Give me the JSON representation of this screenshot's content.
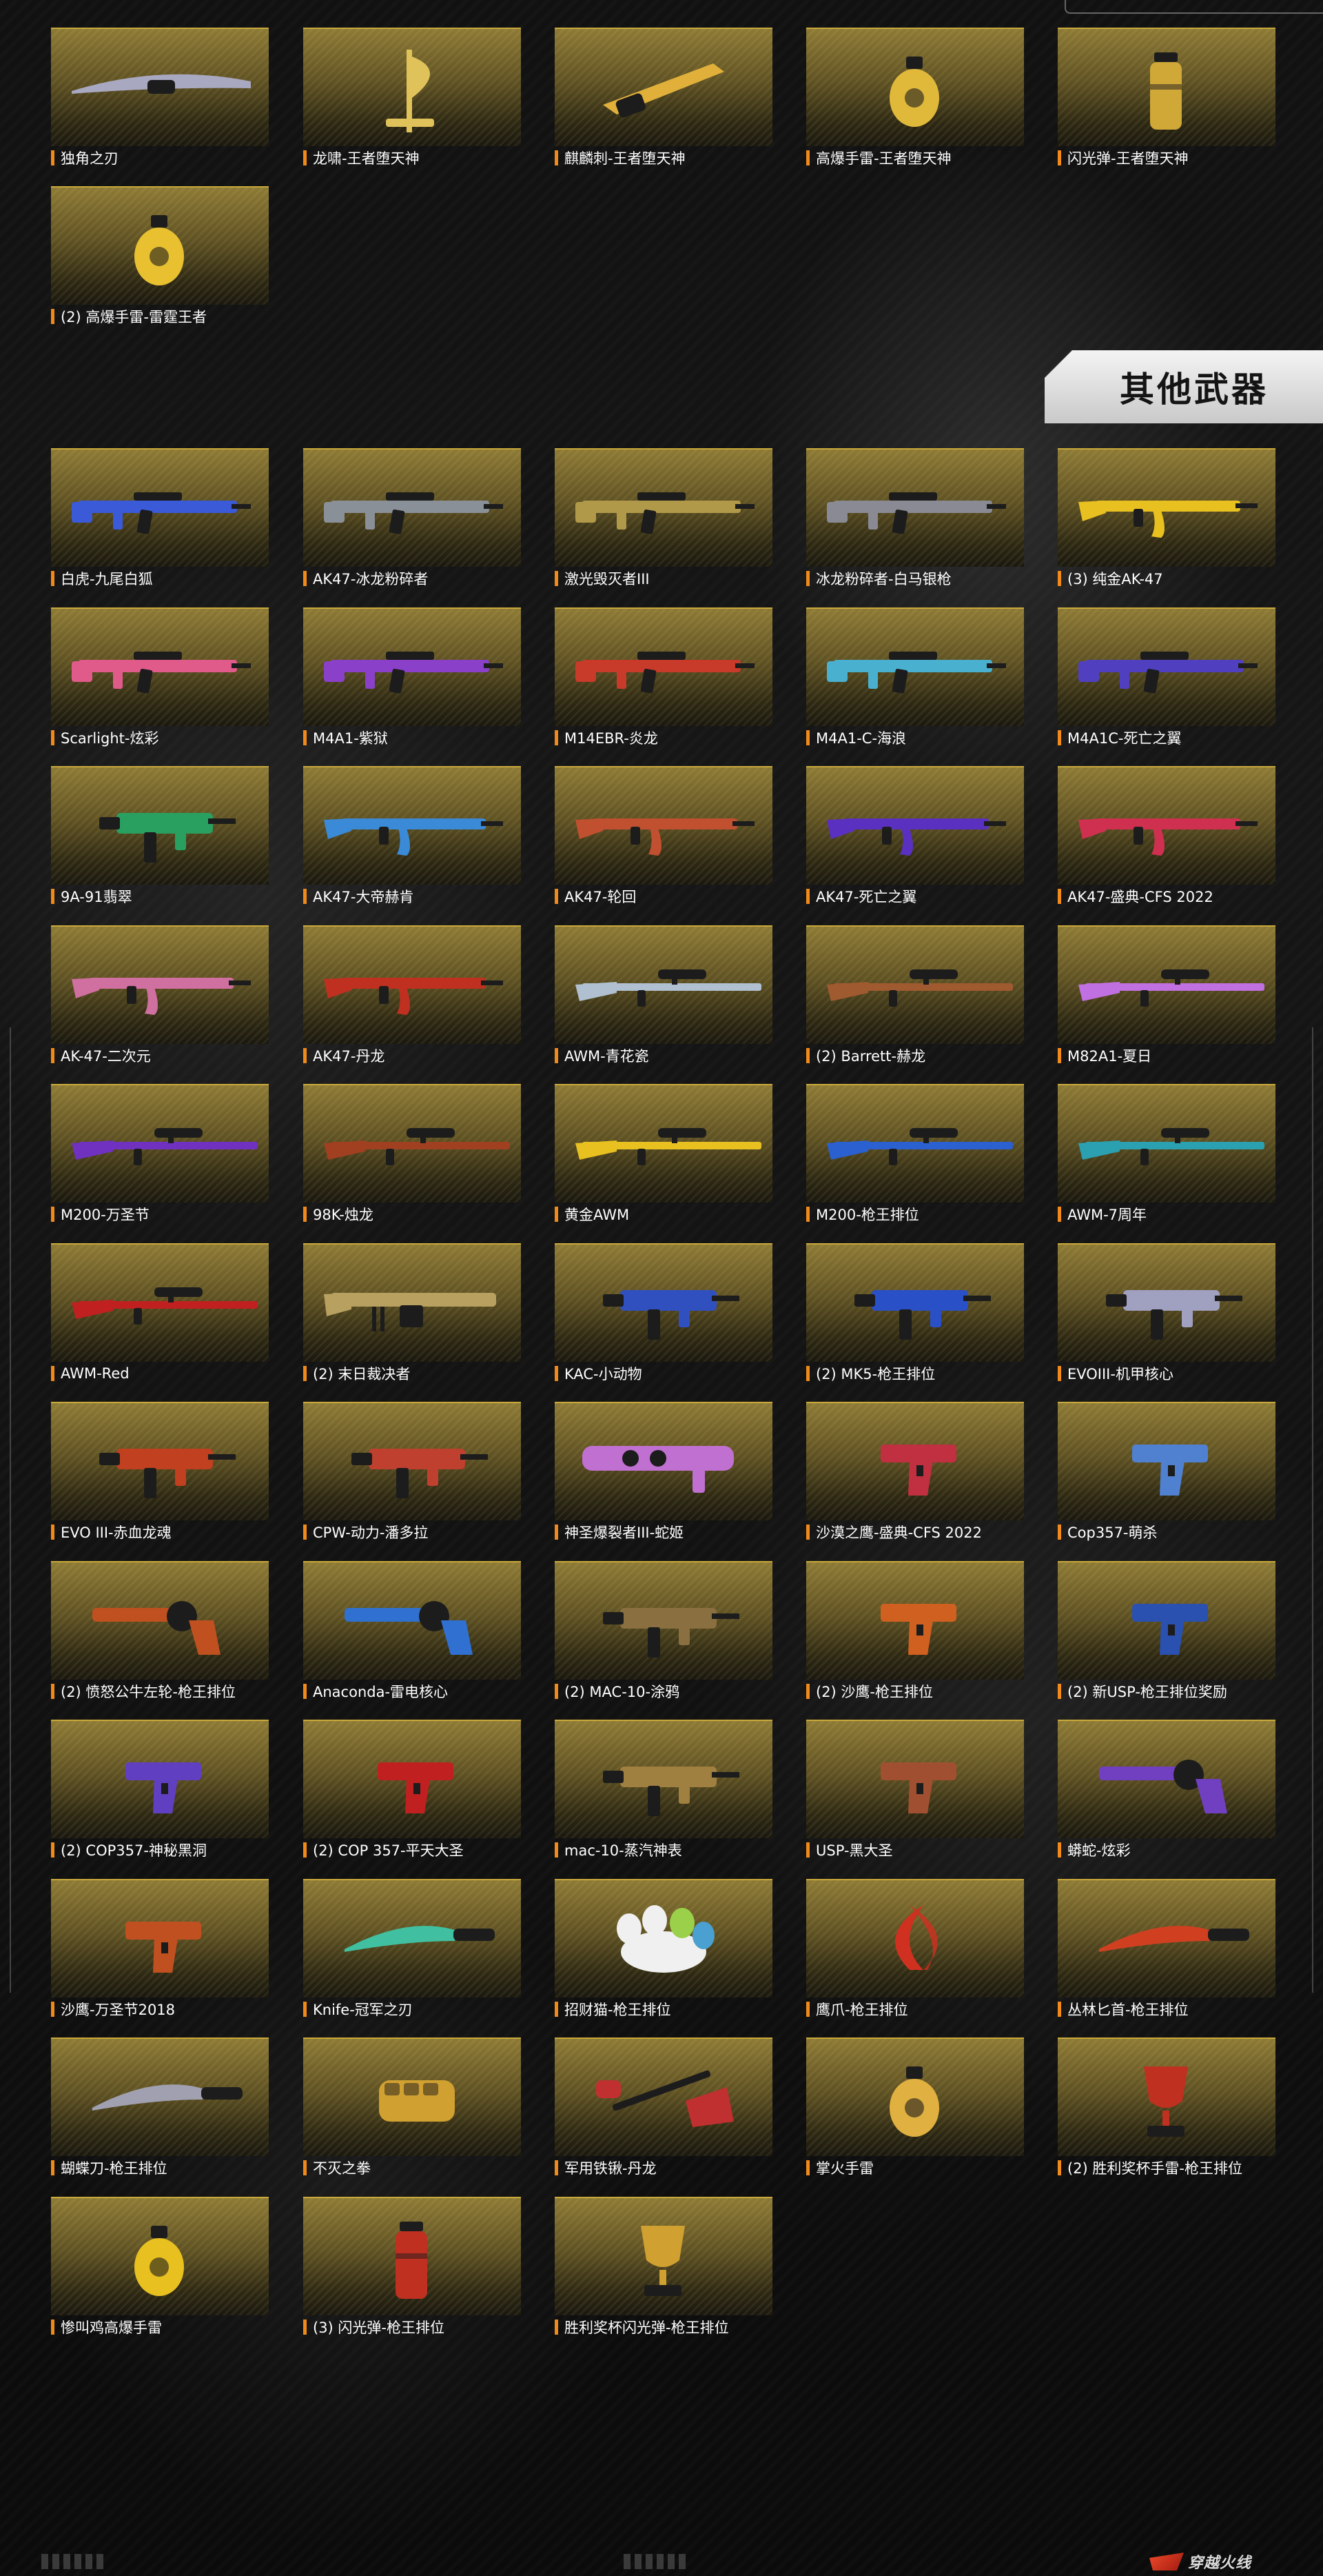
{
  "section_title": "其他武器",
  "footer_logo_text": "穿越火线",
  "colors": {
    "accent_bar": "#f08a1a",
    "card_top": "#8d7a36",
    "card_border": "#c9a93a",
    "header_bg": "#e6e6e6"
  },
  "top_items": [
    {
      "label": "独角之刃",
      "icon": "blade-icon",
      "color": "#a8a8c0"
    },
    {
      "label": "龙啸-王者堕天神",
      "icon": "axe-icon",
      "color": "#e0c25a"
    },
    {
      "label": "麒麟刺-王者堕天神",
      "icon": "dagger-icon",
      "color": "#e0b03a"
    },
    {
      "label": "高爆手雷-王者堕天神",
      "icon": "grenade-icon",
      "color": "#e0b83a"
    },
    {
      "label": "闪光弹-王者堕天神",
      "icon": "flashbang-icon",
      "color": "#d0a838"
    },
    {
      "label": "(2) 高爆手雷-雷霆王者",
      "icon": "grenade-icon",
      "color": "#e8c030"
    }
  ],
  "other_weapons": [
    {
      "label": "白虎-九尾白狐",
      "icon": "rifle-icon",
      "color": "#3a5ad8"
    },
    {
      "label": "AK47-冰龙粉碎者",
      "icon": "rifle-icon",
      "color": "#8a9098"
    },
    {
      "label": "激光毁灭者III",
      "icon": "rifle-icon",
      "color": "#b09a4a"
    },
    {
      "label": "冰龙粉碎者-白马银枪",
      "icon": "rifle-icon",
      "color": "#8a8a94"
    },
    {
      "label": "(3) 纯金AK-47",
      "icon": "ak-icon",
      "color": "#e8c020"
    },
    {
      "label": "Scarlight-炫彩",
      "icon": "rifle-icon",
      "color": "#e05a8a"
    },
    {
      "label": "M4A1-紫狱",
      "icon": "rifle-icon",
      "color": "#8a40c8"
    },
    {
      "label": "M14EBR-炎龙",
      "icon": "rifle-icon",
      "color": "#c83a2a"
    },
    {
      "label": "M4A1-C-海浪",
      "icon": "rifle-icon",
      "color": "#4ab0d0"
    },
    {
      "label": "M4A1C-死亡之翼",
      "icon": "rifle-icon",
      "color": "#5040c0"
    },
    {
      "label": "9A-91翡翠",
      "icon": "smg-icon",
      "color": "#2aa060"
    },
    {
      "label": "AK47-大帝赫肯",
      "icon": "ak-icon",
      "color": "#3a8ad8"
    },
    {
      "label": "AK47-轮回",
      "icon": "ak-icon",
      "color": "#c05030"
    },
    {
      "label": "AK47-死亡之翼",
      "icon": "ak-icon",
      "color": "#5a30c0"
    },
    {
      "label": "AK47-盛典-CFS 2022",
      "icon": "ak-icon",
      "color": "#d03050"
    },
    {
      "label": "AK-47-二次元",
      "icon": "ak-icon",
      "color": "#d070a0"
    },
    {
      "label": "AK47-丹龙",
      "icon": "ak-icon",
      "color": "#c03020"
    },
    {
      "label": "AWM-青花瓷",
      "icon": "sniper-icon",
      "color": "#b0c0d0"
    },
    {
      "label": "(2) Barrett-赫龙",
      "icon": "sniper-icon",
      "color": "#a05a30"
    },
    {
      "label": "M82A1-夏日",
      "icon": "sniper-icon",
      "color": "#c070e0"
    },
    {
      "label": "M200-万圣节",
      "icon": "sniper-icon",
      "color": "#7030c0"
    },
    {
      "label": "98K-烛龙",
      "icon": "sniper-icon",
      "color": "#a04020"
    },
    {
      "label": "黄金AWM",
      "icon": "sniper-icon",
      "color": "#e8c020"
    },
    {
      "label": "M200-枪王排位",
      "icon": "sniper-icon",
      "color": "#2a60d0"
    },
    {
      "label": "AWM-7周年",
      "icon": "sniper-icon",
      "color": "#2aa0b0"
    },
    {
      "label": "AWM-Red",
      "icon": "sniper-icon",
      "color": "#c02020"
    },
    {
      "label": "(2) 末日裁决者",
      "icon": "machinegun-icon",
      "color": "#b8a060"
    },
    {
      "label": "KAC-小动物",
      "icon": "smg-icon",
      "color": "#3050c0"
    },
    {
      "label": "(2) MK5-枪王排位",
      "icon": "smg-icon",
      "color": "#2a50c8"
    },
    {
      "label": "EVOIII-机甲核心",
      "icon": "smg-icon",
      "color": "#a0a0c0"
    },
    {
      "label": "EVO III-赤血龙魂",
      "icon": "smg-icon",
      "color": "#c04020"
    },
    {
      "label": "CPW-动力-潘多拉",
      "icon": "smg-icon",
      "color": "#c04030"
    },
    {
      "label": "神圣爆裂者III-蛇姬",
      "icon": "launcher-icon",
      "color": "#c070d0"
    },
    {
      "label": "沙漠之鹰-盛典-CFS 2022",
      "icon": "pistol-icon",
      "color": "#c03040"
    },
    {
      "label": "Cop357-萌杀",
      "icon": "pistol-icon",
      "color": "#5080d0"
    },
    {
      "label": "(2) 愤怒公牛左轮-枪王排位",
      "icon": "revolver-icon",
      "color": "#c05020"
    },
    {
      "label": "Anaconda-雷电核心",
      "icon": "revolver-icon",
      "color": "#3070d0"
    },
    {
      "label": "(2) MAC-10-涂鸦",
      "icon": "smg-icon",
      "color": "#8a7040"
    },
    {
      "label": "(2) 沙鹰-枪王排位",
      "icon": "pistol-icon",
      "color": "#d06020"
    },
    {
      "label": "(2) 新USP-枪王排位奖励",
      "icon": "pistol-icon",
      "color": "#2a50b0"
    },
    {
      "label": "(2) COP357-神秘黑洞",
      "icon": "pistol-icon",
      "color": "#6040c0"
    },
    {
      "label": "(2) COP 357-平天大圣",
      "icon": "pistol-icon",
      "color": "#c02020"
    },
    {
      "label": "mac-10-蒸汽神表",
      "icon": "smg-icon",
      "color": "#a08040"
    },
    {
      "label": "USP-黑大圣",
      "icon": "pistol-icon",
      "color": "#a05030"
    },
    {
      "label": "蟒蛇-炫彩",
      "icon": "revolver-icon",
      "color": "#7040c0"
    },
    {
      "label": "沙鹰-万圣节2018",
      "icon": "pistol-icon",
      "color": "#c05020"
    },
    {
      "label": "Knife-冠军之刃",
      "icon": "knife-icon",
      "color": "#40c0a0"
    },
    {
      "label": "招财猫-枪王排位",
      "icon": "paw-icon",
      "color": "#f0f0f0"
    },
    {
      "label": "鹰爪-枪王排位",
      "icon": "claw-icon",
      "color": "#d03020"
    },
    {
      "label": "丛林匕首-枪王排位",
      "icon": "knife-icon",
      "color": "#d04020"
    },
    {
      "label": "蝴蝶刀-枪王排位",
      "icon": "knife-icon",
      "color": "#a0a0b0"
    },
    {
      "label": "不灭之拳",
      "icon": "fist-icon",
      "color": "#d0a030"
    },
    {
      "label": "军用铁锹-丹龙",
      "icon": "shovel-icon",
      "color": "#c03030"
    },
    {
      "label": "掌火手雷",
      "icon": "grenade-icon",
      "color": "#e0b040"
    },
    {
      "label": "(2) 胜利奖杯手雷-枪王排位",
      "icon": "trophy-icon",
      "color": "#c03020"
    },
    {
      "label": "惨叫鸡高爆手雷",
      "icon": "grenade-icon",
      "color": "#e8c020"
    },
    {
      "label": "(3) 闪光弹-枪王排位",
      "icon": "flashbang-icon",
      "color": "#c03020"
    },
    {
      "label": "胜利奖杯闪光弹-枪王排位",
      "icon": "trophy-icon",
      "color": "#d0a030"
    }
  ]
}
